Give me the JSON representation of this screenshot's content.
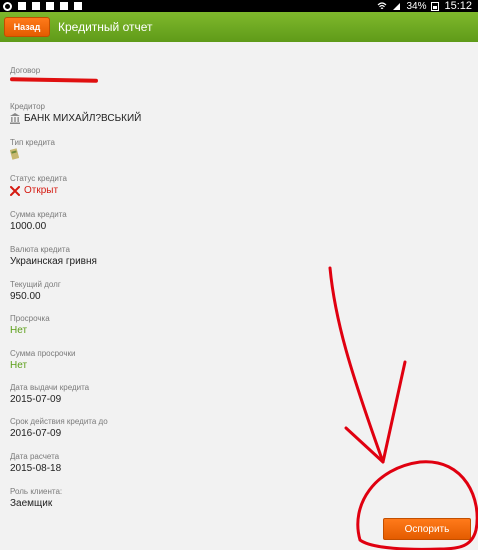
{
  "status_bar": {
    "battery_percent": "34%",
    "time": "15:12"
  },
  "app_bar": {
    "back_label": "Назад",
    "title": "Кредитный отчет"
  },
  "fields": {
    "contract": {
      "label": "Договор",
      "value": ""
    },
    "creditor": {
      "label": "Кредитор",
      "value": "БАНК МИХАЙЛ?ВСЬКИЙ",
      "icon": "bank-icon"
    },
    "credit_type": {
      "label": "Тип кредита",
      "icon": "credit-type-icon"
    },
    "credit_status": {
      "label": "Статус кредита",
      "value": "Открыт",
      "icon": "close-x-icon",
      "color": "#d51b12"
    },
    "credit_amount": {
      "label": "Сумма кредита",
      "value": "1000.00"
    },
    "credit_currency": {
      "label": "Валюта кредита",
      "value": "Украинская гривня"
    },
    "current_debt": {
      "label": "Текущий долг",
      "value": "950.00"
    },
    "overdue": {
      "label": "Просрочка",
      "value": "Нет",
      "color": "#5a9e16"
    },
    "overdue_amount": {
      "label": "Сумма просрочки",
      "value": "Нет",
      "color": "#5a9e16"
    },
    "issue_date": {
      "label": "Дата выдачи кредита",
      "value": "2015-07-09"
    },
    "due_date": {
      "label": "Срок действия кредита до",
      "value": "2016-07-09"
    },
    "calc_date": {
      "label": "Дата расчета",
      "value": "2015-08-18"
    },
    "client_role": {
      "label": "Роль клиента:",
      "value": "Заемщик"
    }
  },
  "dispute_button": {
    "label": "Оспорить"
  },
  "colors": {
    "app_bar": "#6aa71f",
    "accent_orange": "#ff6a00",
    "status_red": "#d51b12",
    "status_green": "#5a9e16",
    "annotation_red": "#e00010"
  }
}
